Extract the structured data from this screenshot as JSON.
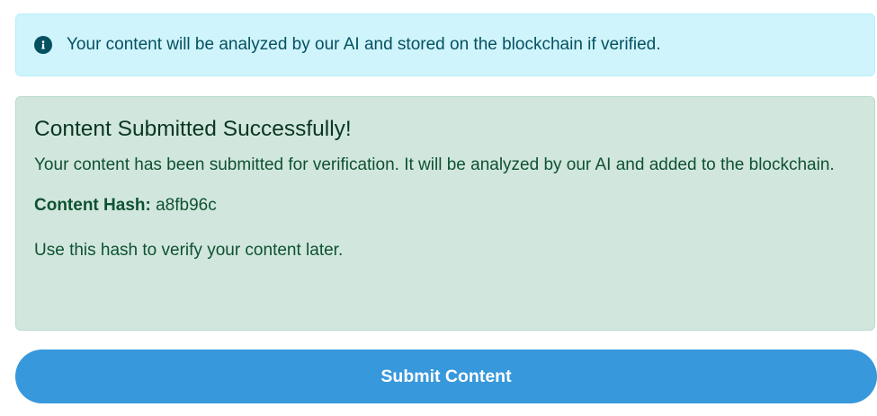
{
  "info_alert": {
    "icon": "info-circle-icon",
    "text": "Your content will be analyzed by our AI and stored on the blockchain if verified.",
    "background": "#cff4fc",
    "text_color": "#055160"
  },
  "success_alert": {
    "title": "Content Submitted Successfully!",
    "message": "Your content has been submitted for verification. It will be analyzed by our AI and added to the blockchain.",
    "hash_label": "Content Hash:",
    "hash_value": "a8fb96c",
    "note": "Use this hash to verify your content later.",
    "background": "#d1e7dd",
    "text_color": "#0f5132"
  },
  "submit_button": {
    "label": "Submit Content",
    "background": "#3798dc"
  }
}
